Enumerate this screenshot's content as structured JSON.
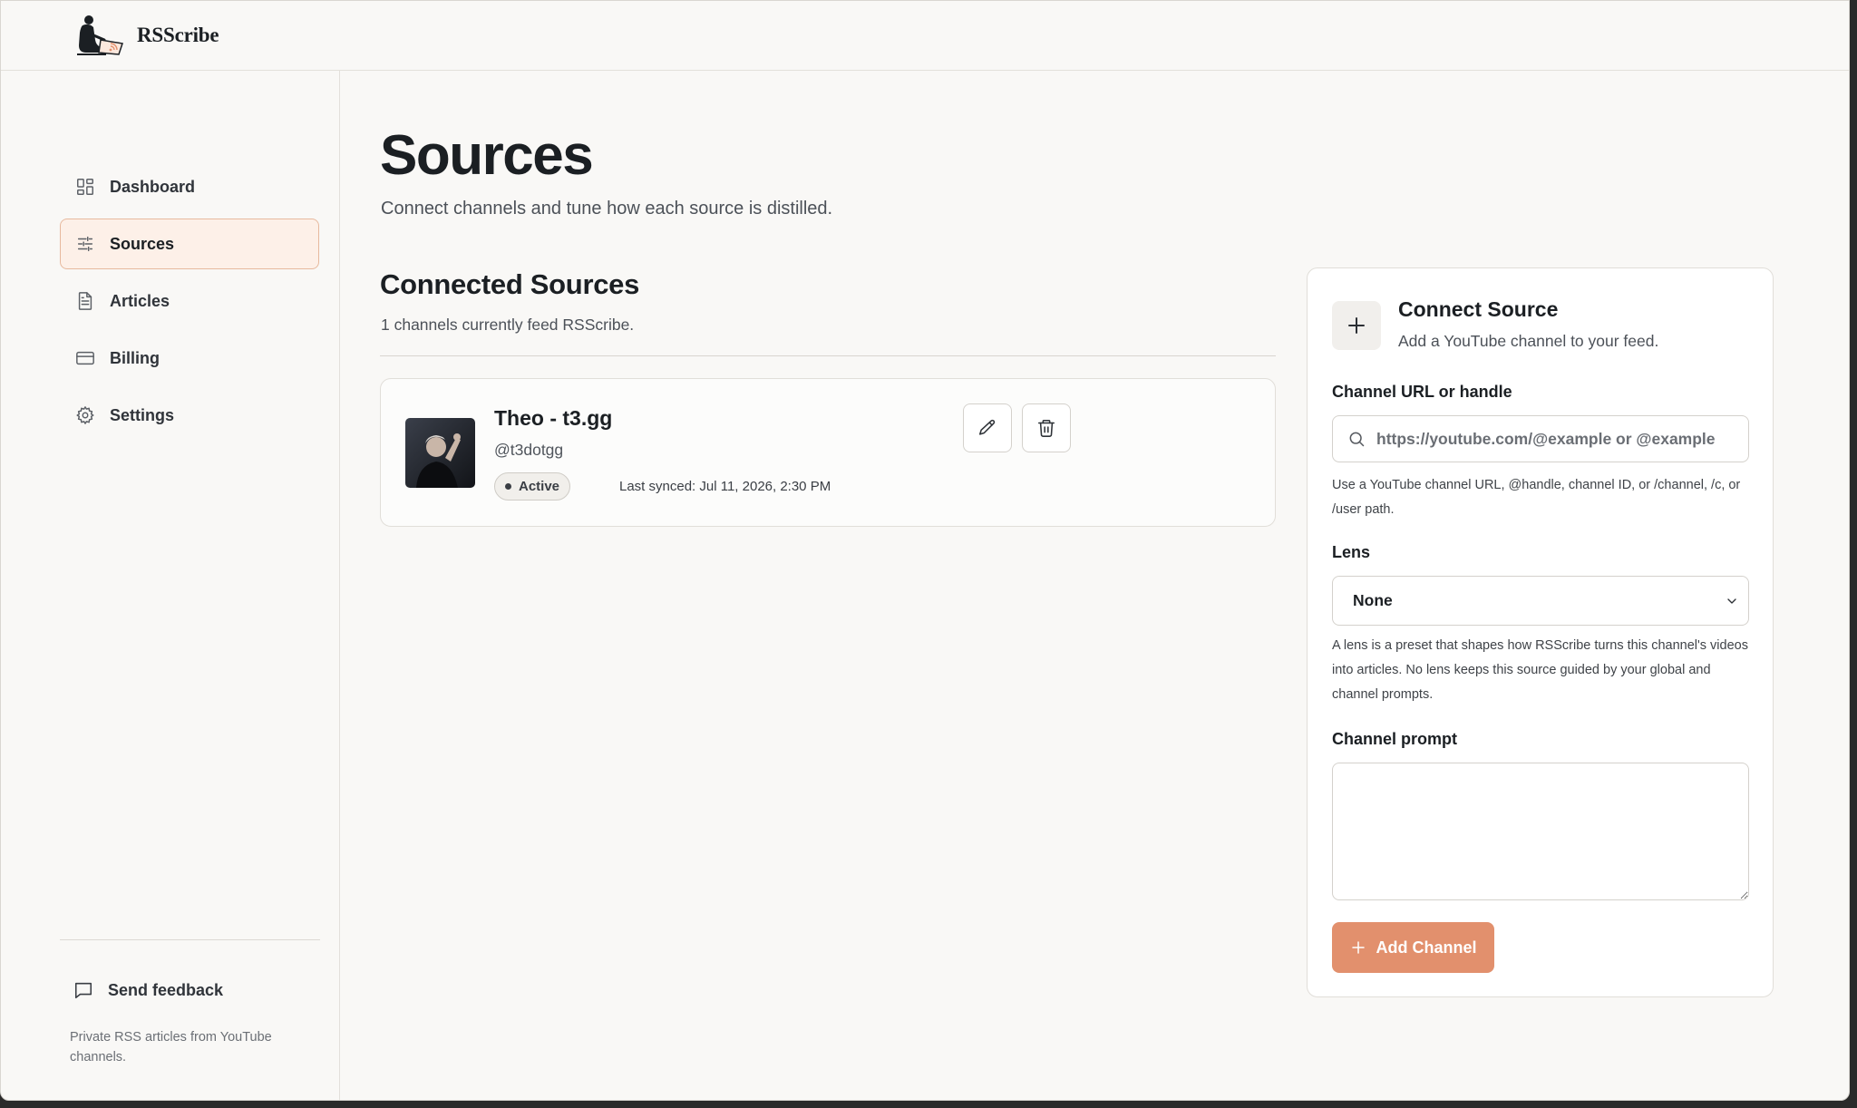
{
  "app": {
    "name": "RSScribe"
  },
  "sidebar": {
    "items": [
      {
        "label": "Dashboard",
        "icon": "dashboard-icon",
        "active": false
      },
      {
        "label": "Sources",
        "icon": "sliders-icon",
        "active": true
      },
      {
        "label": "Articles",
        "icon": "document-icon",
        "active": false
      },
      {
        "label": "Billing",
        "icon": "credit-card-icon",
        "active": false
      },
      {
        "label": "Settings",
        "icon": "gear-icon",
        "active": false
      }
    ],
    "feedback_label": "Send feedback",
    "footer_note": "Private RSS articles from YouTube channels."
  },
  "main": {
    "title": "Sources",
    "subtitle": "Connect channels and tune how each source is distilled.",
    "connected": {
      "title": "Connected Sources",
      "summary": "1 channels currently feed RSScribe.",
      "sources": [
        {
          "name": "Theo - t3.gg",
          "handle": "@t3dotgg",
          "status": "Active",
          "last_synced": "Last synced: Jul 11, 2026, 2:30 PM"
        }
      ]
    }
  },
  "connect_panel": {
    "title": "Connect Source",
    "subtitle": "Add a YouTube channel to your feed.",
    "url_label": "Channel URL or handle",
    "url_placeholder": "https://youtube.com/@example or @example",
    "url_value": "",
    "url_help": "Use a YouTube channel URL, @handle, channel ID, or /channel, /c, or /user path.",
    "lens_label": "Lens",
    "lens_value": "None",
    "lens_help": "A lens is a preset that shapes how RSScribe turns this channel's videos into articles. No lens keeps this source guided by your global and channel prompts.",
    "prompt_label": "Channel prompt",
    "prompt_value": "",
    "add_label": "Add Channel"
  },
  "colors": {
    "accent": "#e2906d",
    "active_nav_bg": "#fdf0e8",
    "active_nav_border": "#e7b99e",
    "background": "#f9f8f6"
  }
}
